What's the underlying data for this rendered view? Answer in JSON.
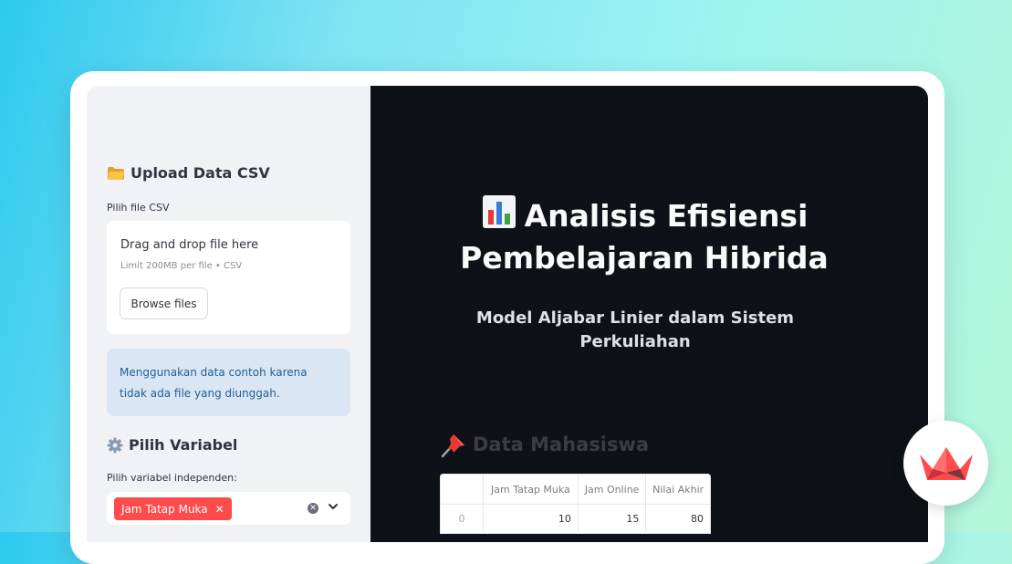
{
  "sidebar": {
    "upload_heading": "Upload Data CSV",
    "upload_icon": "folder-icon",
    "file_label": "Pilih file CSV",
    "dropzone_title": "Drag and drop file here",
    "dropzone_limit": "Limit 200MB per file • CSV",
    "browse_button": "Browse files",
    "info_message": "Menggunakan data contoh karena tidak ada file yang diunggah.",
    "variable_heading": "Pilih Variabel",
    "variable_icon": "gear-icon",
    "independent_label": "Pilih variabel independen:",
    "selected_tags": [
      "Jam Tatap Muka"
    ]
  },
  "main": {
    "title": "Analisis Efisiensi Pembelajaran Hibrida",
    "title_icon": "bar-chart-icon",
    "subtitle": "Model Aljabar Linier dalam Sistem Perkuliahan",
    "data_heading": "Data Mahasiswa",
    "data_icon": "pushpin-icon",
    "table": {
      "columns": [
        "",
        "Jam Tatap Muka",
        "Jam Online",
        "Nilai Akhir"
      ],
      "rows": [
        [
          "0",
          "10",
          "15",
          "80"
        ]
      ]
    }
  },
  "colors": {
    "accent": "#ff4b4b",
    "info_bg": "#dbe6f4",
    "info_text": "#1f5e96",
    "sidebar_bg": "#f0f2f6",
    "main_bg": "#0e1117"
  },
  "badge_icon": "streamlit-crown-icon"
}
